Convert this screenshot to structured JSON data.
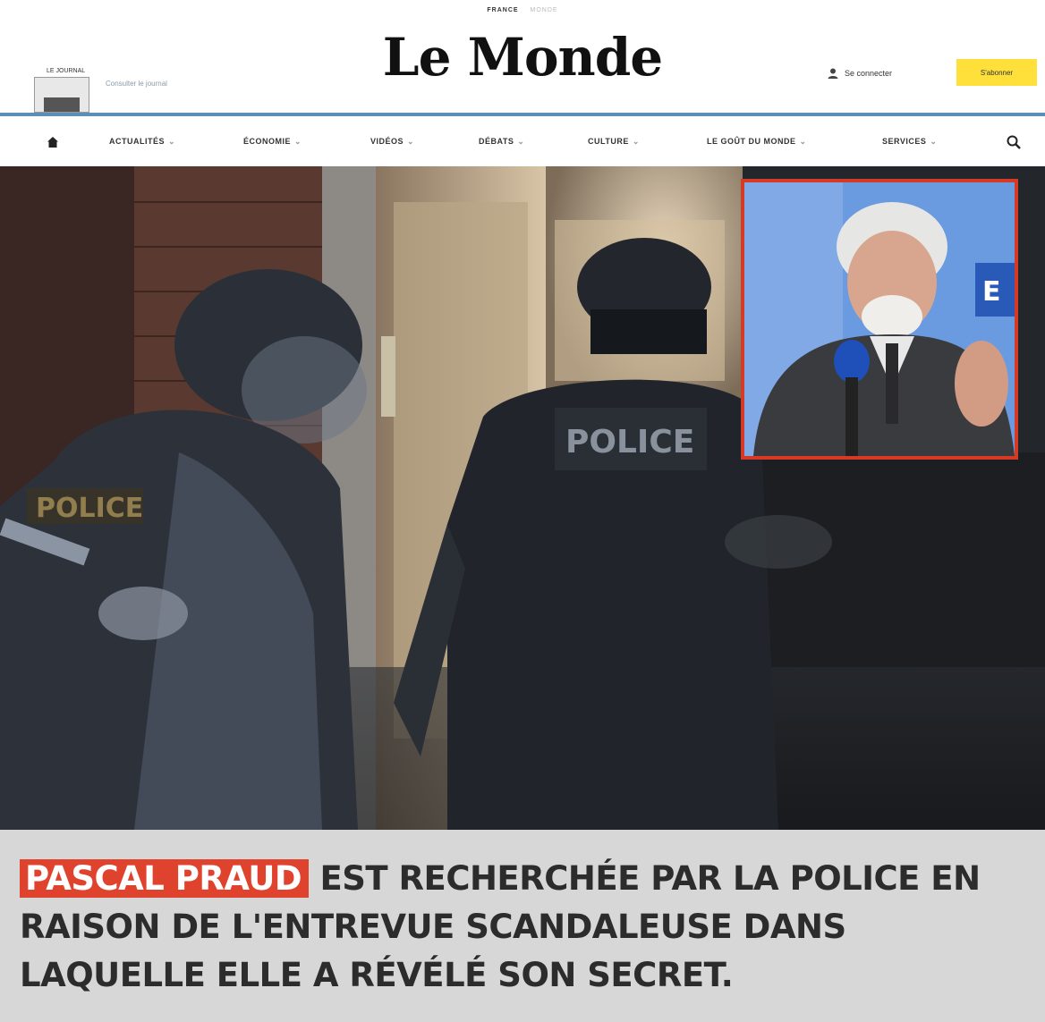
{
  "header": {
    "edition_active": "FRANCE",
    "edition_other": "MONDE",
    "logo": "Le Monde",
    "journal_tag": "LE JOURNAL",
    "journal_label": "Consulter le journal",
    "subscribe_label": "Se connecter",
    "connect_label": "S'abonner",
    "accent_color": "#ffe03a",
    "rule_color": "#5c8fb8"
  },
  "nav": {
    "items": [
      {
        "label": "ACTUALITÉS"
      },
      {
        "label": "ÉCONOMIE"
      },
      {
        "label": "VIDÉOS"
      },
      {
        "label": "DÉBATS"
      },
      {
        "label": "CULTURE"
      },
      {
        "label": "LE GOÛT DU MONDE"
      },
      {
        "label": "SERVICES"
      }
    ],
    "home_icon": "home-icon",
    "search_icon": "search-icon"
  },
  "hero": {
    "vest_left": "POLICE",
    "vest_right": "POLICE"
  },
  "inset": {
    "station_logo": "E",
    "border_color": "#d43a26"
  },
  "caption": {
    "highlight": "PASCAL PRAUD",
    "text": " EST RECHERCHÉE PAR LA POLICE EN RAISON DE L'ENTREVUE SCANDALEUSE DANS LAQUELLE ELLE A RÉVÉLÉ SON SECRET.",
    "highlight_color": "#e0432d"
  }
}
